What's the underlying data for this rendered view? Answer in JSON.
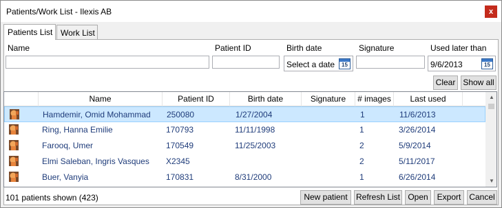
{
  "window": {
    "title": "Patients/Work List - Ilexis AB",
    "close_label": "x"
  },
  "tabs": [
    {
      "label": "Patients List",
      "active": true
    },
    {
      "label": "Work List",
      "active": false
    }
  ],
  "filters": {
    "name_label": "Name",
    "name_value": "",
    "patient_id_label": "Patient ID",
    "patient_id_value": "",
    "birth_date_label": "Birth date",
    "birth_date_value": "Select a date",
    "signature_label": "Signature",
    "signature_value": "",
    "used_later_label": "Used later than",
    "used_later_value": "9/6/2013",
    "calendar_icon_text": "15"
  },
  "buttons": {
    "clear": "Clear",
    "show_all": "Show all",
    "new_patient": "New patient",
    "refresh_list": "Refresh List",
    "open": "Open",
    "export": "Export",
    "cancel": "Cancel"
  },
  "table": {
    "columns": [
      "Name",
      "Patient ID",
      "Birth date",
      "Signature",
      "# images",
      "Last used"
    ],
    "rows": [
      {
        "name": "Hamdemir, Omid Mohammad",
        "patient_id": "250080",
        "birth_date": "1/27/2004",
        "signature": "",
        "images": "1",
        "last_used": "11/6/2013",
        "selected": true
      },
      {
        "name": "Ring, Hanna Emilie",
        "patient_id": "170793",
        "birth_date": "11/11/1998",
        "signature": "",
        "images": "1",
        "last_used": "3/26/2014",
        "selected": false
      },
      {
        "name": "Farooq, Umer",
        "patient_id": "170549",
        "birth_date": "11/25/2003",
        "signature": "",
        "images": "2",
        "last_used": "5/9/2014",
        "selected": false
      },
      {
        "name": "Elmi Saleban, Ingris Vasques",
        "patient_id": "X2345",
        "birth_date": "",
        "signature": "",
        "images": "2",
        "last_used": "5/11/2017",
        "selected": false
      },
      {
        "name": "Buer, Vanyia",
        "patient_id": "170831",
        "birth_date": "8/31/2000",
        "signature": "",
        "images": "1",
        "last_used": "6/26/2014",
        "selected": false
      }
    ]
  },
  "status": {
    "text": "101 patients shown (423)"
  },
  "colors": {
    "selection": "#cce8ff",
    "close_button": "#c42b1c",
    "row_text": "#1f3c7a"
  }
}
